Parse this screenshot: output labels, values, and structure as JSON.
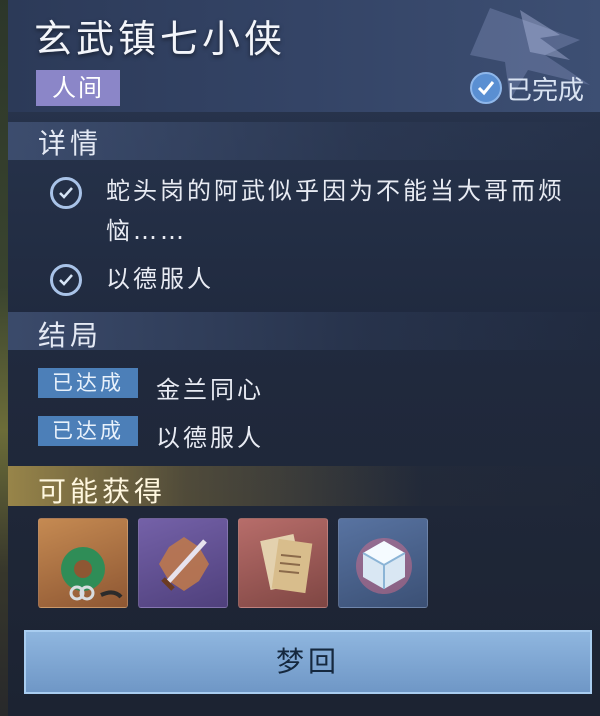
{
  "quest": {
    "title": "玄武镇七小侠",
    "category": "人间",
    "status": "已完成"
  },
  "details": {
    "heading": "详情",
    "items": [
      {
        "line1": "蛇头岗的阿武似乎因为不能当大哥而烦",
        "line2": "恼……"
      },
      {
        "line1": "以德服人",
        "line2": ""
      }
    ]
  },
  "endings": {
    "heading": "结局",
    "items": [
      {
        "badge": "已达成",
        "text": "金兰同心"
      },
      {
        "badge": "已达成",
        "text": "以德服人"
      }
    ]
  },
  "rewards": {
    "heading": "可能获得",
    "items": [
      {
        "icon": "jade-pendant-icon",
        "frame_color": "#c58a52"
      },
      {
        "icon": "dagger-icon",
        "frame_color": "#7461a8"
      },
      {
        "icon": "paper-manual-icon",
        "frame_color": "#b76d6a"
      },
      {
        "icon": "crystal-cube-icon",
        "frame_color": "#5873a1"
      }
    ]
  },
  "action": {
    "button_label": "梦回"
  }
}
